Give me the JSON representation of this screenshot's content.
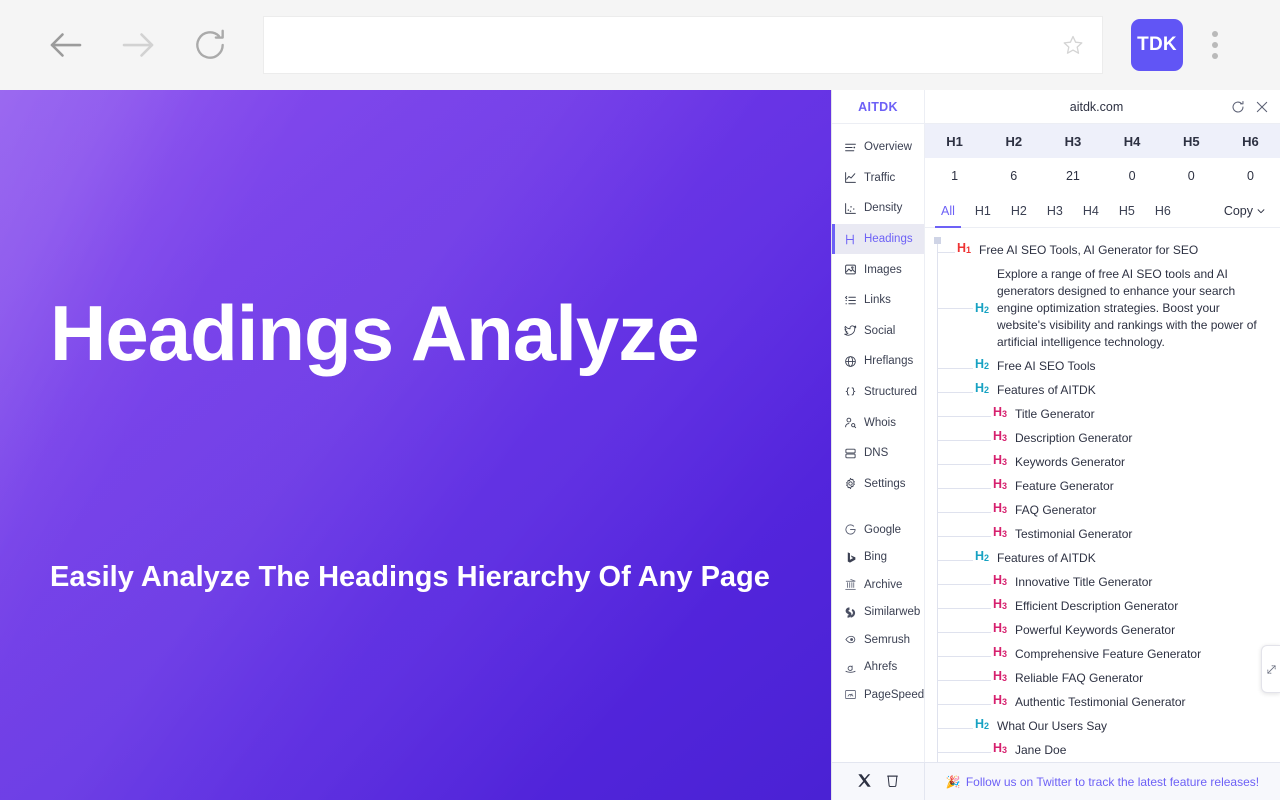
{
  "browser": {
    "back_label": "Back",
    "forward_label": "Forward",
    "reload_label": "Reload",
    "url_value": "",
    "url_placeholder": "",
    "bookmark_label": "Bookmark this tab",
    "extension_badge": "TDK",
    "menu_label": "Customize and control"
  },
  "hero": {
    "title": "Headings Analyze",
    "subtitle": "Easily Analyze The Headings Hierarchy Of Any Page",
    "gradient_from": "#7c3aec",
    "gradient_to": "#4a22d4"
  },
  "panel": {
    "logo": "AITDK",
    "domain": "aitdk.com",
    "refresh_label": "Refresh",
    "close_label": "Close",
    "accent": "#6d61f6",
    "sidebar": {
      "items": [
        {
          "label": "Overview",
          "icon": "overview-icon",
          "active": false
        },
        {
          "label": "Traffic",
          "icon": "traffic-icon",
          "active": false
        },
        {
          "label": "Density",
          "icon": "density-icon",
          "active": false
        },
        {
          "label": "Headings",
          "icon": "headings-icon",
          "active": true
        },
        {
          "label": "Images",
          "icon": "images-icon",
          "active": false
        },
        {
          "label": "Links",
          "icon": "links-icon",
          "active": false
        },
        {
          "label": "Social",
          "icon": "social-icon",
          "active": false
        },
        {
          "label": "Hreflangs",
          "icon": "globe-icon",
          "active": false
        },
        {
          "label": "Structured",
          "icon": "braces-icon",
          "active": false
        },
        {
          "label": "Whois",
          "icon": "whois-icon",
          "active": false
        },
        {
          "label": "DNS",
          "icon": "dns-icon",
          "active": false
        },
        {
          "label": "Settings",
          "icon": "gear-icon",
          "active": false
        }
      ],
      "links": [
        {
          "label": "Google",
          "icon": "google-icon"
        },
        {
          "label": "Bing",
          "icon": "bing-icon"
        },
        {
          "label": "Archive",
          "icon": "archive-icon"
        },
        {
          "label": "Similarweb",
          "icon": "similarweb-icon"
        },
        {
          "label": "Semrush",
          "icon": "semrush-icon"
        },
        {
          "label": "Ahrefs",
          "icon": "ahrefs-icon"
        },
        {
          "label": "PageSpeed",
          "icon": "pagespeed-icon"
        }
      ]
    },
    "counts": {
      "headers": [
        "H1",
        "H2",
        "H3",
        "H4",
        "H5",
        "H6"
      ],
      "values": [
        "1",
        "6",
        "21",
        "0",
        "0",
        "0"
      ]
    },
    "filter_tabs": [
      {
        "label": "All",
        "active": true
      },
      {
        "label": "H1",
        "active": false
      },
      {
        "label": "H2",
        "active": false
      },
      {
        "label": "H3",
        "active": false
      },
      {
        "label": "H4",
        "active": false
      },
      {
        "label": "H5",
        "active": false
      },
      {
        "label": "H6",
        "active": false
      }
    ],
    "copy_label": "Copy",
    "headings": [
      {
        "level": 1,
        "tag": "H1",
        "text": "Free AI SEO Tools, AI Generator for SEO"
      },
      {
        "level": 2,
        "tag": "H2",
        "text": "Explore a range of free AI SEO tools and AI generators designed to enhance your search engine optimization strategies. Boost your website's visibility and rankings with the power of artificial intelligence technology."
      },
      {
        "level": 2,
        "tag": "H2",
        "text": "Free AI SEO Tools"
      },
      {
        "level": 2,
        "tag": "H2",
        "text": "Features of AITDK"
      },
      {
        "level": 3,
        "tag": "H3",
        "text": "Title Generator"
      },
      {
        "level": 3,
        "tag": "H3",
        "text": "Description Generator"
      },
      {
        "level": 3,
        "tag": "H3",
        "text": "Keywords Generator"
      },
      {
        "level": 3,
        "tag": "H3",
        "text": "Feature Generator"
      },
      {
        "level": 3,
        "tag": "H3",
        "text": "FAQ Generator"
      },
      {
        "level": 3,
        "tag": "H3",
        "text": "Testimonial Generator"
      },
      {
        "level": 2,
        "tag": "H2",
        "text": "Features of AITDK"
      },
      {
        "level": 3,
        "tag": "H3",
        "text": "Innovative Title Generator"
      },
      {
        "level": 3,
        "tag": "H3",
        "text": "Efficient Description Generator"
      },
      {
        "level": 3,
        "tag": "H3",
        "text": "Powerful Keywords Generator"
      },
      {
        "level": 3,
        "tag": "H3",
        "text": "Comprehensive Feature Generator"
      },
      {
        "level": 3,
        "tag": "H3",
        "text": "Reliable FAQ Generator"
      },
      {
        "level": 3,
        "tag": "H3",
        "text": "Authentic Testimonial Generator"
      },
      {
        "level": 2,
        "tag": "H2",
        "text": "What Our Users Say"
      },
      {
        "level": 3,
        "tag": "H3",
        "text": "Jane Doe"
      }
    ],
    "footer": {
      "twitter_label": "X",
      "buymecoffee_label": "Buy me a coffee",
      "message": "Follow us on Twitter to track the latest feature releases!",
      "message_emoji": "🎉"
    }
  },
  "float_handle": {
    "label": "Open panel",
    "icon": "chart-handle-icon"
  }
}
